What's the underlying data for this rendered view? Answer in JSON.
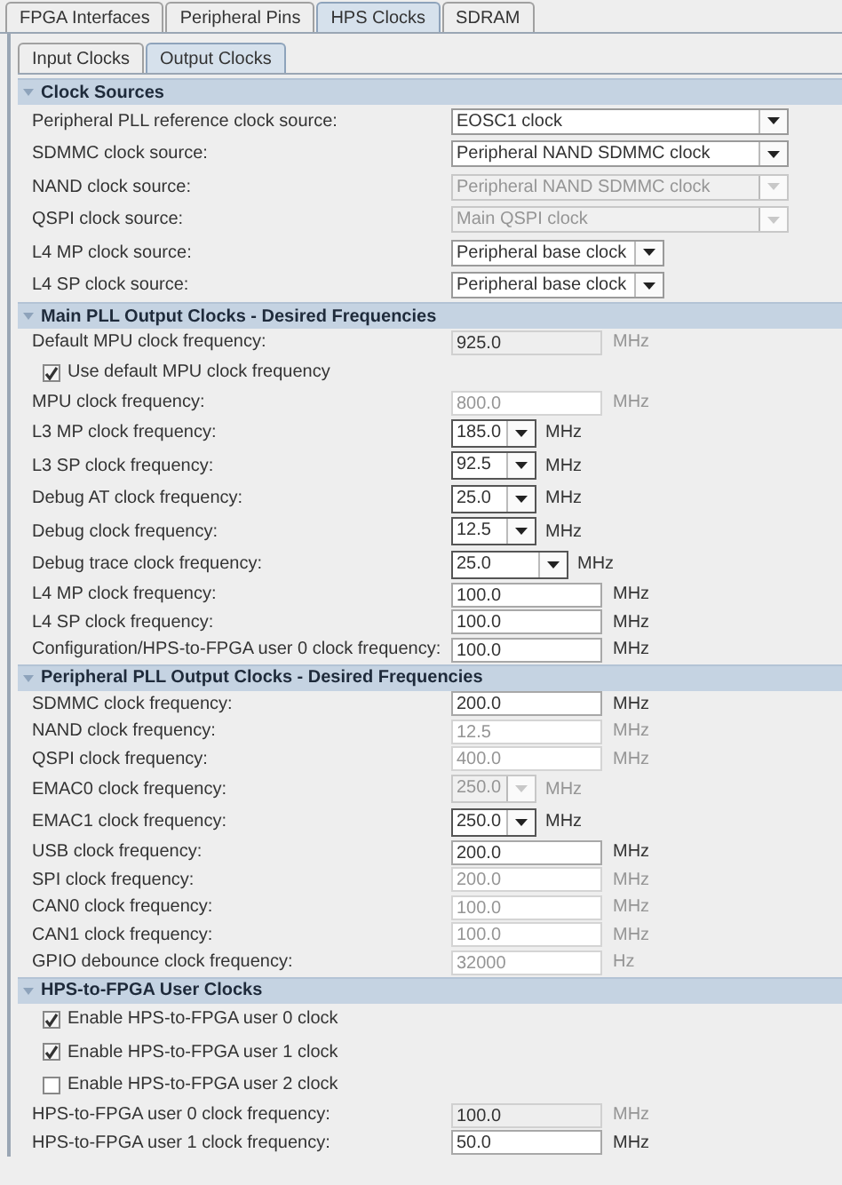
{
  "tabs": [
    {
      "label": "FPGA Interfaces",
      "selected": false
    },
    {
      "label": "Peripheral Pins",
      "selected": false
    },
    {
      "label": "HPS Clocks",
      "selected": true
    },
    {
      "label": "SDRAM",
      "selected": false
    }
  ],
  "subtabs": [
    {
      "label": "Input Clocks",
      "selected": false
    },
    {
      "label": "Output Clocks",
      "selected": true
    }
  ],
  "sections": [
    {
      "title": "Clock Sources",
      "expanded": true,
      "rows": [
        {
          "kind": "select",
          "label": "Peripheral PLL reference clock source:",
          "value": "EOSC1 clock",
          "wide": true,
          "disabled": false
        },
        {
          "kind": "select",
          "label": "SDMMC clock source:",
          "value": "Peripheral NAND SDMMC clock",
          "wide": true,
          "disabled": false
        },
        {
          "kind": "select",
          "label": "NAND clock source:",
          "value": "Peripheral NAND SDMMC clock",
          "wide": true,
          "disabled": true
        },
        {
          "kind": "select",
          "label": "QSPI clock source:",
          "value": "Main QSPI clock",
          "wide": true,
          "disabled": true
        },
        {
          "kind": "select",
          "label": "L4 MP clock source:",
          "value": "Peripheral base clock",
          "wide": false,
          "disabled": false
        },
        {
          "kind": "select",
          "label": "L4 SP clock source:",
          "value": "Peripheral base clock",
          "wide": false,
          "disabled": false
        }
      ]
    },
    {
      "title": "Main PLL Output Clocks - Desired Frequencies",
      "expanded": true,
      "rows": [
        {
          "kind": "readout",
          "label": "Default MPU clock frequency:",
          "value": "925.0",
          "unit": "MHz"
        },
        {
          "kind": "checkbox",
          "label": "Use default MPU clock frequency",
          "checked": true
        },
        {
          "kind": "field",
          "label": "MPU clock frequency:",
          "value": "800.0",
          "unit": "MHz",
          "disabled": true
        },
        {
          "kind": "combo",
          "label": "L3 MP clock frequency:",
          "value": "185.0",
          "unit": "MHz",
          "disabled": false
        },
        {
          "kind": "combo",
          "label": "L3 SP clock frequency:",
          "value": "92.5",
          "unit": "MHz",
          "disabled": false
        },
        {
          "kind": "combo",
          "label": "Debug AT clock frequency:",
          "value": "25.0",
          "unit": "MHz",
          "disabled": false
        },
        {
          "kind": "combo",
          "label": "Debug clock frequency:",
          "value": "12.5",
          "unit": "MHz",
          "disabled": false
        },
        {
          "kind": "combo",
          "label": "Debug trace clock frequency:",
          "value": "25.0",
          "unit": "MHz",
          "disabled": false,
          "wide": true
        },
        {
          "kind": "field",
          "label": "L4 MP clock frequency:",
          "value": "100.0",
          "unit": "MHz",
          "disabled": false
        },
        {
          "kind": "field",
          "label": "L4 SP clock frequency:",
          "value": "100.0",
          "unit": "MHz",
          "disabled": false
        },
        {
          "kind": "field",
          "label": "Configuration/HPS-to-FPGA user 0 clock frequency:",
          "value": "100.0",
          "unit": "MHz",
          "disabled": false
        }
      ]
    },
    {
      "title": "Peripheral PLL Output Clocks - Desired Frequencies",
      "expanded": true,
      "rows": [
        {
          "kind": "field",
          "label": "SDMMC clock frequency:",
          "value": "200.0",
          "unit": "MHz",
          "disabled": false
        },
        {
          "kind": "field",
          "label": "NAND clock frequency:",
          "value": "12.5",
          "unit": "MHz",
          "disabled": true
        },
        {
          "kind": "field",
          "label": "QSPI clock frequency:",
          "value": "400.0",
          "unit": "MHz",
          "disabled": true
        },
        {
          "kind": "combo",
          "label": "EMAC0 clock frequency:",
          "value": "250.0",
          "unit": "MHz",
          "disabled": true
        },
        {
          "kind": "combo",
          "label": "EMAC1 clock frequency:",
          "value": "250.0",
          "unit": "MHz",
          "disabled": false
        },
        {
          "kind": "field",
          "label": "USB clock frequency:",
          "value": "200.0",
          "unit": "MHz",
          "disabled": false
        },
        {
          "kind": "field",
          "label": "SPI clock frequency:",
          "value": "200.0",
          "unit": "MHz",
          "disabled": true
        },
        {
          "kind": "field",
          "label": "CAN0 clock frequency:",
          "value": "100.0",
          "unit": "MHz",
          "disabled": true
        },
        {
          "kind": "field",
          "label": "CAN1 clock frequency:",
          "value": "100.0",
          "unit": "MHz",
          "disabled": true
        },
        {
          "kind": "field",
          "label": "GPIO debounce clock frequency:",
          "value": "32000",
          "unit": "Hz",
          "disabled": true
        }
      ]
    },
    {
      "title": "HPS-to-FPGA User Clocks",
      "expanded": true,
      "rows": [
        {
          "kind": "checkbox",
          "label": "Enable HPS-to-FPGA user 0 clock",
          "checked": true
        },
        {
          "kind": "checkbox",
          "label": "Enable HPS-to-FPGA user 1 clock",
          "checked": true
        },
        {
          "kind": "checkbox",
          "label": "Enable HPS-to-FPGA user 2 clock",
          "checked": false
        },
        {
          "kind": "readout",
          "label": "HPS-to-FPGA user 0 clock frequency:",
          "value": "100.0",
          "unit": "MHz"
        },
        {
          "kind": "field",
          "label": "HPS-to-FPGA user 1 clock frequency:",
          "value": "50.0",
          "unit": "MHz",
          "disabled": false
        }
      ]
    }
  ]
}
